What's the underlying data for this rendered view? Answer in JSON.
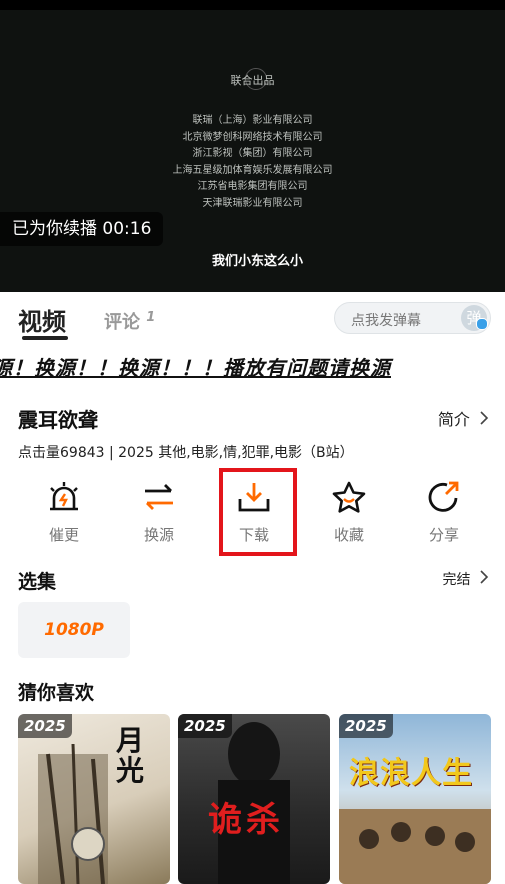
{
  "player": {
    "credits_title": "联合出品",
    "credits": [
      "联瑞（上海）影业有限公司",
      "北京微梦创科网络技术有限公司",
      "浙江影视（集团）有限公司",
      "上海五星级加体育娱乐发展有限公司",
      "江苏省电影集团有限公司",
      "天津联瑞影业有限公司"
    ],
    "continue_text": "已为你续播 00:16",
    "subtitle": "我们小东这么小"
  },
  "tabs": {
    "video": "视频",
    "comments": "评论",
    "comment_count": "1"
  },
  "danmu": {
    "placeholder": "点我发弹幕",
    "icon_text": "弹"
  },
  "marquee": "源！换源！！换源！！！播放有问题请换源",
  "show": {
    "title": "震耳欲聋",
    "intro_label": "简介",
    "meta": "点击量69843 | 2025 其他,电影,情,犯罪,电影（B站）"
  },
  "actions": [
    {
      "label": "催更",
      "icon": "alarm-icon"
    },
    {
      "label": "换源",
      "icon": "swap-icon"
    },
    {
      "label": "下载",
      "icon": "download-icon"
    },
    {
      "label": "收藏",
      "icon": "star-icon"
    },
    {
      "label": "分享",
      "icon": "share-icon"
    }
  ],
  "episodes": {
    "title": "选集",
    "status": "完结",
    "items": [
      "1080P"
    ]
  },
  "recommend": {
    "title": "猜你喜欢",
    "posters": [
      {
        "year": "2025",
        "title": "月光"
      },
      {
        "year": "2025",
        "title": "诡杀"
      },
      {
        "year": "2025",
        "title": "浪浪人生"
      }
    ]
  },
  "colors": {
    "accent": "#ff6a00",
    "highlight": "#e3151b"
  }
}
